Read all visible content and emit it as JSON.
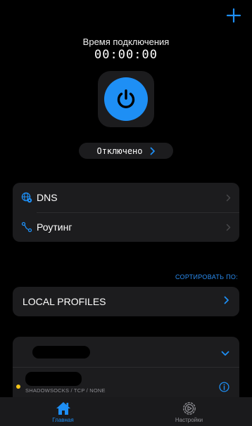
{
  "header": {
    "add_icon": "plus-icon",
    "title": "Время подключения",
    "timer": "00:00:00"
  },
  "power": {
    "icon": "power-icon",
    "status": "Отключено"
  },
  "settings": {
    "items": [
      {
        "label": "DNS",
        "icon": "globe-gear-icon"
      },
      {
        "label": "Роутинг",
        "icon": "route-icon"
      }
    ]
  },
  "sort": {
    "label": "СОРТИРОВАТЬ ПО:"
  },
  "local_profiles": {
    "label": "LOCAL PROFILES"
  },
  "server": {
    "protocol": "SHADOWSOCKS / TCP / NONE",
    "status_color": "#f5c518"
  },
  "tabbar": {
    "tabs": [
      {
        "label": "Главная",
        "icon": "house-icon",
        "active": true
      },
      {
        "label": "Настройки",
        "icon": "gear-icon",
        "active": false
      }
    ]
  },
  "colors": {
    "accent": "#1e8ff5",
    "card": "#1c1c1e",
    "background": "#000000"
  }
}
